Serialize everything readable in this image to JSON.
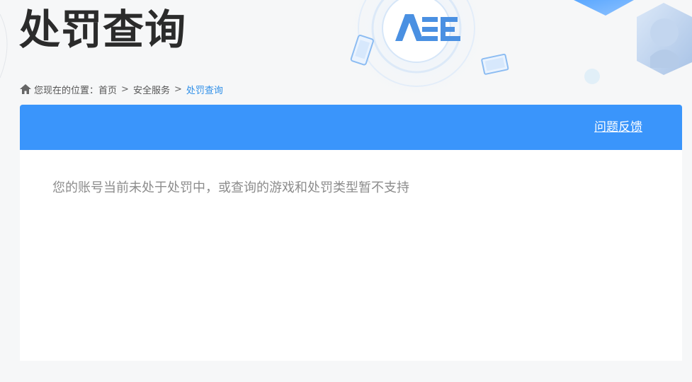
{
  "header": {
    "title": "处罚查询",
    "logo_text": "ACE"
  },
  "breadcrumb": {
    "prefix": "您现在的位置：",
    "items": [
      "首页",
      "安全服务",
      "处罚查询"
    ],
    "separator": ">"
  },
  "panel": {
    "feedback_label": "问题反馈",
    "message": "您的账号当前未处于处罚中，或查询的游戏和处罚类型暂不支持"
  },
  "colors": {
    "accent": "#3a95fb",
    "link_current": "#2f8fe8",
    "title": "#2b2b2b",
    "message": "#8c8c8c"
  },
  "icons": {
    "home": "home-icon"
  }
}
